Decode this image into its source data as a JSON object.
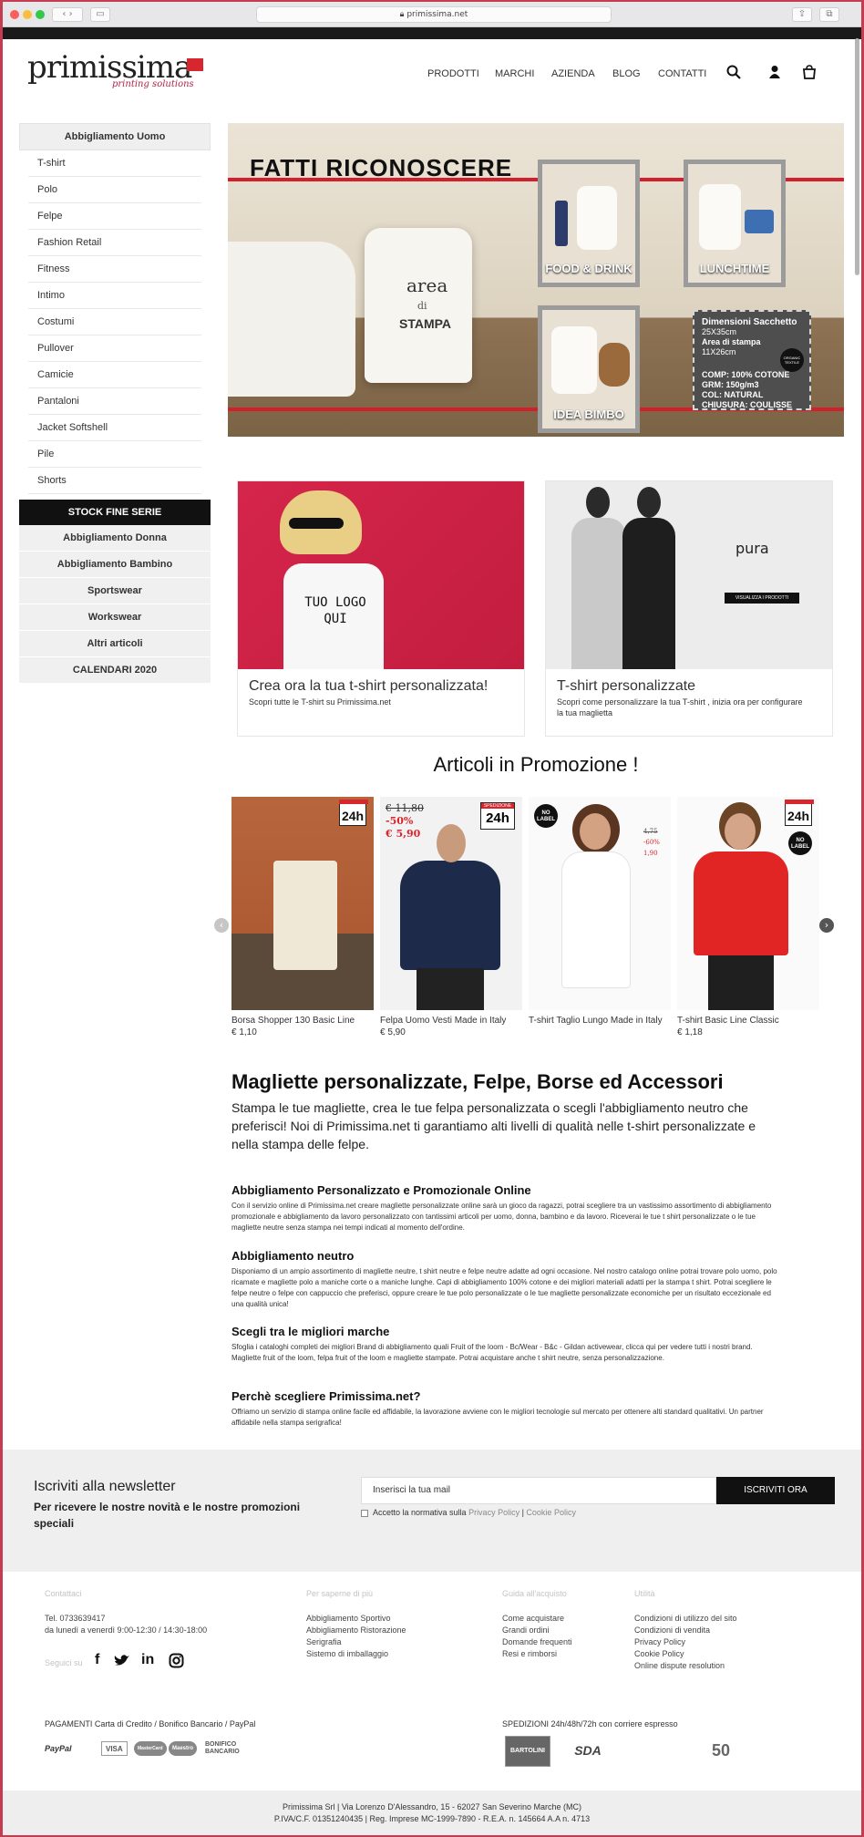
{
  "browser": {
    "url": "primissima.net"
  },
  "header": {
    "logo_text": "primissima",
    "logo_tagline": "printing solutions",
    "nav": [
      "PRODOTTI",
      "MARCHI",
      "AZIENDA",
      "BLOG",
      "CONTATTI"
    ]
  },
  "sidebar": {
    "heading": "Abbigliamento Uomo",
    "items": [
      "T-shirt",
      "Polo",
      "Felpe",
      "Fashion Retail",
      "Fitness",
      "Intimo",
      "Costumi",
      "Pullover",
      "Camicie",
      "Pantaloni",
      "Jacket Softshell",
      "Pile",
      "Shorts"
    ],
    "stock": "STOCK FINE SERIE",
    "categories": [
      "Abbigliamento Donna",
      "Abbigliamento Bambino",
      "Sportswear",
      "Workswear",
      "Altri articoli",
      "CALENDARI 2020"
    ]
  },
  "hero": {
    "title": "FATTI RICONOSCERE",
    "bag_area": "area",
    "bag_di": "di",
    "bag_stampa": "STAMPA",
    "tiles": [
      "FOOD & DRINK",
      "LUNCHTIME",
      "IDEA BIMBO"
    ],
    "spec": {
      "title": "Dimensioni Sacchetto",
      "size": "25X35cm",
      "area_label": "Area di stampa",
      "area_size": "11X26cm",
      "organic": "ORGANIC TEXTILE",
      "comp": "COMP: 100% COTONE",
      "grm": "GRM: 150g/m3",
      "col": "COL: NATURAL",
      "chiusura": "CHIUSURA: COULISSE"
    }
  },
  "promo_cards": [
    {
      "img_text": "TUO LOGO QUI",
      "title": "Crea ora la tua t-shirt personalizzata!",
      "sub": "Scopri tutte le T-shirt su Primissima.net"
    },
    {
      "brand": "pura",
      "button": "VISUALIZZA I PRODOTTI",
      "title": "T-shirt personalizzate",
      "sub": "Scopri come personalizzare la tua T-shirt , inizia ora per configurare la tua maglietta"
    }
  ],
  "promo_title": "Articoli in Promozione !",
  "products": [
    {
      "name": "Borsa Shopper 130 Basic Line",
      "price": "€ 1,10",
      "badge": "24h"
    },
    {
      "name": "Felpa Uomo Vesti Made in Italy",
      "price": "€ 5,90",
      "old_price": "€ 11,80",
      "discount": "-50%",
      "new_price": "€ 5,90",
      "badge": "24h",
      "badge_top": "SPEDIZIONE"
    },
    {
      "name": "T-shirt Taglio Lungo Made in Italy",
      "price": "",
      "badge_label": "NO LABEL"
    },
    {
      "name": "T-shirt Basic Line Classic",
      "price": "€ 1,18",
      "old_price": "4,75",
      "discount": "-60%",
      "new_price": "1,90",
      "badge": "24h",
      "badge_label": "NO LABEL"
    }
  ],
  "content": {
    "title": "Magliette personalizzate, Felpe, Borse ed Accessori",
    "intro": "Stampa le tue magliette, crea le tue felpa personalizzata o scegli l'abbigliamento neutro che preferisci! Noi di Primissima.net ti garantiamo alti livelli di qualità nelle t-shirt personalizzate e nella stampa delle felpe.",
    "sections": [
      {
        "h": "Abbigliamento Personalizzato e Promozionale Online",
        "p": "Con il servizio online di Primissima.net creare magliette personalizzate online sarà un gioco da ragazzi, potrai scegliere tra un vastissimo assortimento di abbigliamento promozionale e abbigliamento da lavoro personalizzato con tantissimi articoli per uomo, donna, bambino e da lavoro. Riceverai le tue t shirt personalizzate o le tue magliette neutre senza stampa nei tempi indicati al momento dell'ordine."
      },
      {
        "h": "Abbigliamento neutro",
        "p": "Disponiamo di un ampio assortimento di magliette neutre, t shirt neutre e felpe neutre adatte ad ogni occasione. Nel nostro catalogo online potrai trovare polo uomo, polo ricamate e magliette polo a maniche corte o a maniche lunghe. Capi di abbigliamento 100% cotone e dei migliori materiali adatti per la stampa t shirt. Potrai scegliere le felpe neutre o felpe con cappuccio che preferisci, oppure creare le tue polo personalizzate o le tue magliette personalizzate economiche per un risultato eccezionale ed una qualità unica!"
      },
      {
        "h": "Scegli tra le migliori marche",
        "p": "Sfoglia i cataloghi completi dei migliori Brand di abbigliamento quali Fruit of the loom - Bc/Wear - B&c - Gildan activewear, clicca qui per vedere tutti i nostri brand. Magliette fruit of the loom, felpa fruit of the loom e magliette stampate. Potrai acquistare anche t shirt neutre, senza personalizzazione."
      },
      {
        "h": "Perchè scegliere Primissima.net?",
        "p": "Offriamo un servizio di stampa online facile ed affidabile, la lavorazione avviene con le migliori tecnologie sul mercato per ottenere alti standard qualitativi. Un partner affidabile nella stampa serigrafica!"
      }
    ]
  },
  "newsletter": {
    "title": "Iscriviti alla newsletter",
    "sub": "Per ricevere le nostre novità e le nostre promozioni speciali",
    "placeholder": "Inserisci la tua mail",
    "button": "ISCRIVITI ORA",
    "terms_prefix": "Accetto la normativa sulla",
    "privacy": "Privacy Policy",
    "cookie": "Cookie Policy"
  },
  "footer": {
    "contacts": {
      "heading": "Contattaci",
      "tel": "Tel. 0733639417",
      "hours": "da lunedì a venerdì 9:00-12:30 / 14:30-18:00",
      "follow": "Seguici su"
    },
    "col2": {
      "heading": "Per saperne di più",
      "links": [
        "Abbigliamento Sportivo",
        "Abbigliamento Ristorazione",
        "Serigrafia",
        "Sistemo di imballaggio"
      ]
    },
    "col3": {
      "heading": "Guida all'acquisto",
      "links": [
        "Come acquistare",
        "Grandi ordini",
        "Domande frequenti",
        "Resi e rimborsi"
      ]
    },
    "col4": {
      "heading": "Utilità",
      "links": [
        "Condizioni di utilizzo del sito",
        "Condizioni di vendita",
        "Privacy Policy",
        "Cookie Policy",
        "Online dispute resolution"
      ]
    },
    "payments": "PAGAMENTI Carta di Credito / Bonifico Bancario / PayPal",
    "payment_logos": [
      "PayPal",
      "VISA",
      "MasterCard",
      "Maestro",
      "BONIFICO BANCARIO"
    ],
    "shipping": "SPEDIZIONI 24h/48h/72h con corriere espresso",
    "shipping_logos": [
      "BARTOLINI",
      "SDA",
      "50"
    ],
    "bottom_line1": "Primissima Srl | Via Lorenzo D'Alessandro, 15 - 62027 San Severino Marche (MC)",
    "bottom_line2": "P.IVA/C.F. 01351240435 | Reg. Imprese MC-1999-7890 - R.E.A. n. 145664 A.A n. 4713"
  },
  "colors": {
    "brand_red": "#d7262e",
    "dark": "#111111"
  }
}
